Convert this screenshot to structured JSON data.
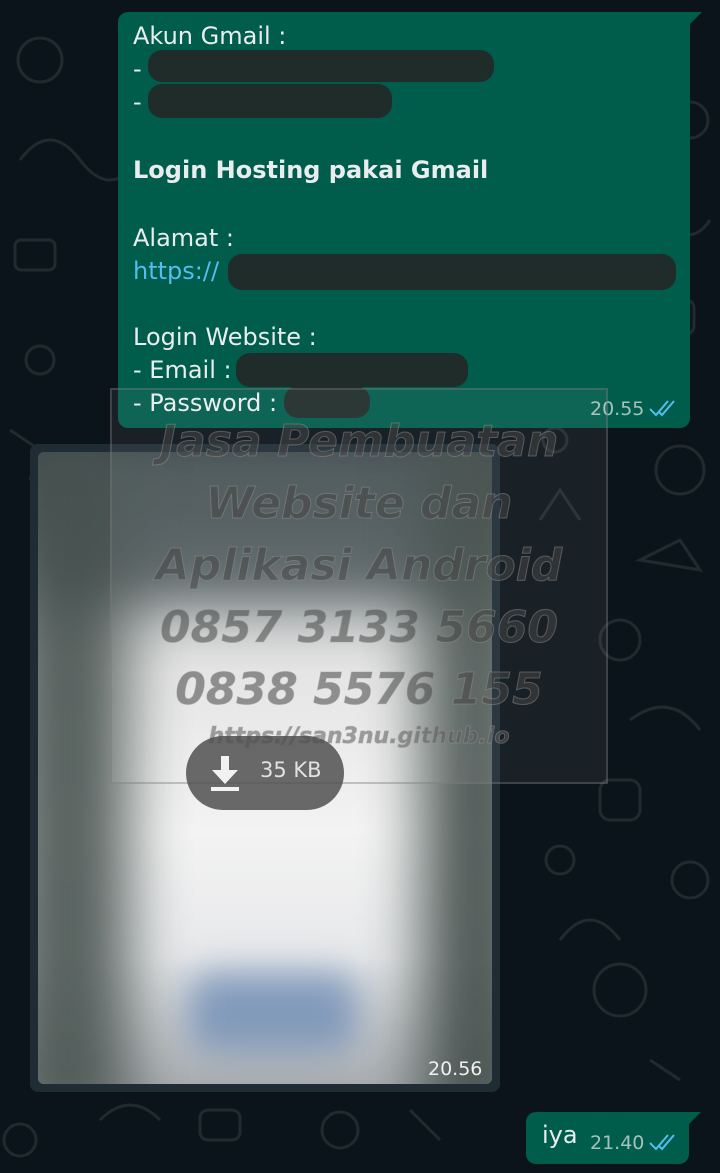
{
  "messages": {
    "first": {
      "gmail_label": "Akun Gmail :",
      "dash1": "-",
      "dash2": "-",
      "hosting_heading": "Login Hosting pakai Gmail",
      "alamat_label": "Alamat :",
      "link_prefix": "https://",
      "website_label": "Login Website :",
      "email_label": "- Email :",
      "password_label": "- Password :",
      "time": "20.55"
    },
    "image": {
      "file_size": "35 KB",
      "time": "20.56"
    },
    "reply": {
      "text": "iya",
      "time": "21.40"
    }
  },
  "watermark": {
    "line1": "Jasa Pembuatan",
    "line2": "Website dan",
    "line3": "Aplikasi Android",
    "line4": "0857 3133 5660",
    "line5": "0838 5576 155",
    "url": "https://san3nu.github.io"
  },
  "colors": {
    "background": "#0b141a",
    "outgoing_bubble": "#005c4b",
    "incoming_bubble": "#1f2c33",
    "link": "#53bdeb",
    "read_ticks": "#53bdeb"
  },
  "icons": {
    "read_receipt": "double-check-icon",
    "download": "download-arrow-icon"
  }
}
